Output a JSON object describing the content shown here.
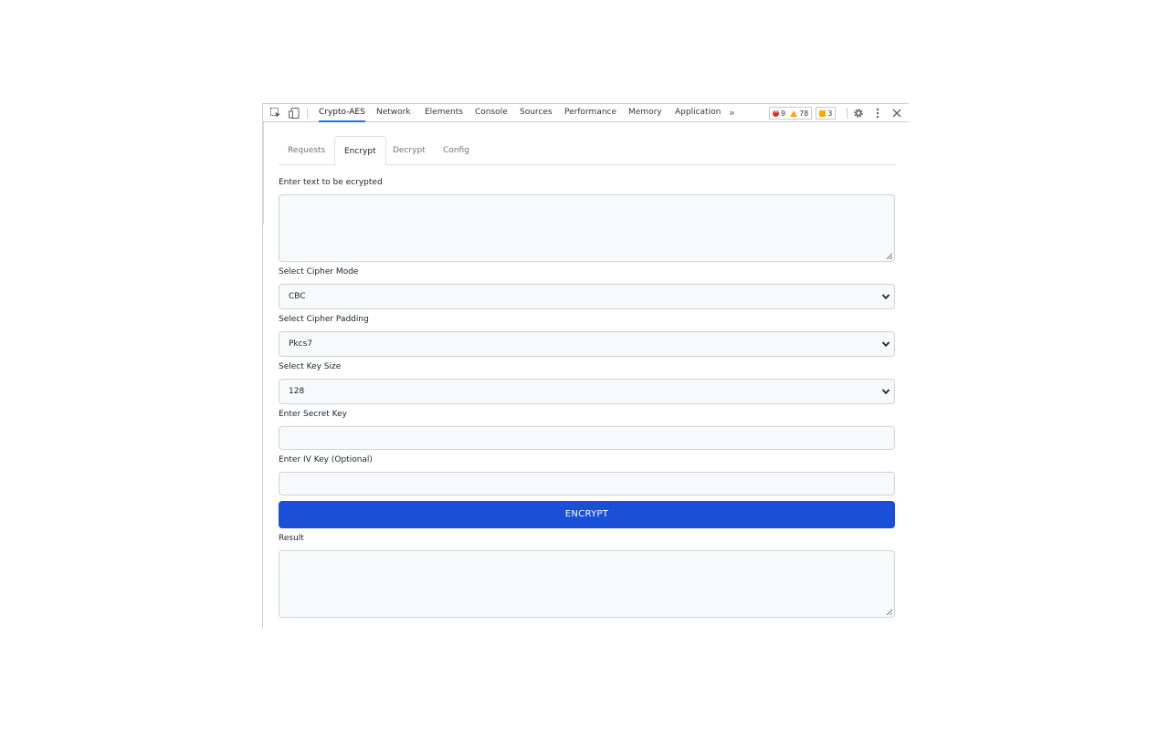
{
  "toolbar": {
    "tabs": [
      "Crypto-AES",
      "Network",
      "Elements",
      "Console",
      "Sources",
      "Performance",
      "Memory",
      "Application"
    ],
    "more": "»",
    "errors": "9",
    "warnings": "78",
    "issues": "3"
  },
  "panel": {
    "tabs": [
      "Requests",
      "Encrypt",
      "Decrypt",
      "Config"
    ],
    "active_tab": "Encrypt"
  },
  "form": {
    "text_label": "Enter text to be ecrypted",
    "text_value": "",
    "mode_label": "Select Cipher Mode",
    "mode_value": "CBC",
    "padding_label": "Select Cipher Padding",
    "padding_value": "Pkcs7",
    "keysize_label": "Select Key Size",
    "keysize_value": "128",
    "secret_label": "Enter Secret Key",
    "secret_value": "",
    "iv_label": "Enter IV Key (Optional)",
    "iv_value": "",
    "button_label": "ENCRYPT",
    "result_label": "Result",
    "result_value": ""
  },
  "colors": {
    "accent": "#1a73e8",
    "button": "#1a4fd8",
    "error": "#d93025",
    "warning": "#f9ab00"
  },
  "icons": [
    "inspect-element-icon",
    "device-toolbar-icon",
    "more-tabs-icon",
    "settings-gear-icon",
    "kebab-menu-icon",
    "close-icon",
    "chevron-down-icon"
  ]
}
